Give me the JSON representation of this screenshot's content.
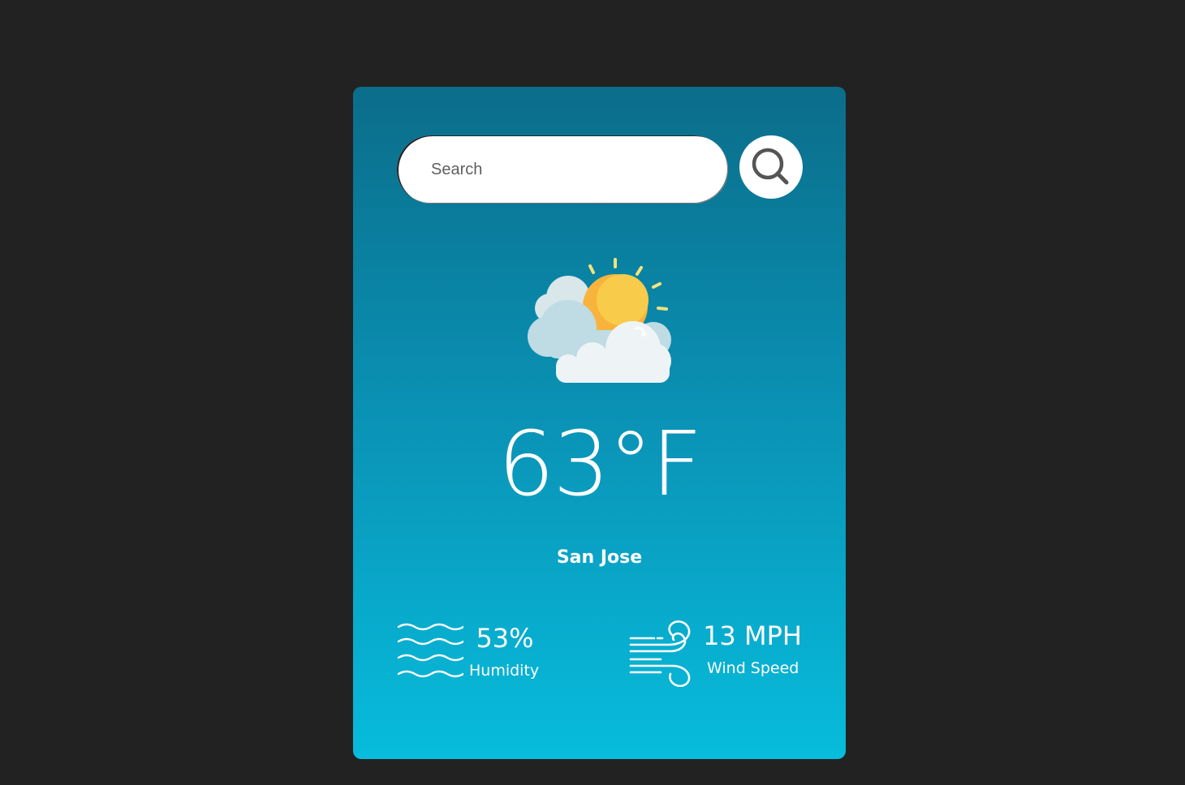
{
  "search": {
    "placeholder": "Search",
    "value": ""
  },
  "weather": {
    "icon": "partly-cloudy-icon",
    "temperature": "63°F",
    "city": "San Jose"
  },
  "details": {
    "humidity": {
      "icon": "humidity-icon",
      "value": "53%",
      "label": "Humidity"
    },
    "wind": {
      "icon": "wind-icon",
      "value": "13 MPH",
      "label": "Wind Speed"
    }
  },
  "colors": {
    "page_background": "#222222",
    "card_gradient_top": "#0b6d8a",
    "card_gradient_bottom": "#07bcdc",
    "sun": "#f8c846",
    "cloud": "#eef3f5"
  }
}
